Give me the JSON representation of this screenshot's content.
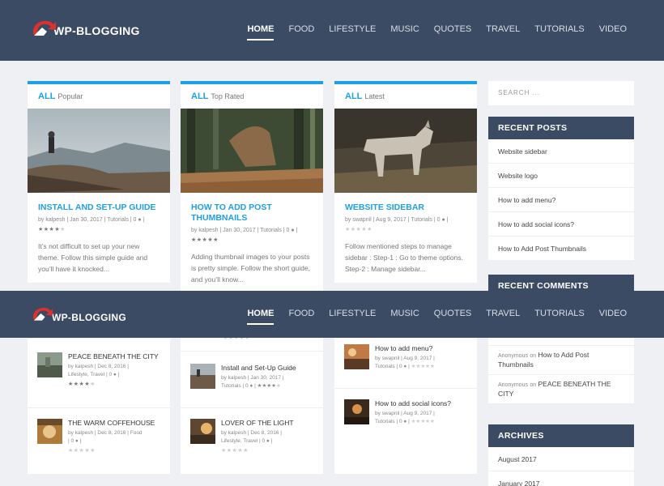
{
  "header": {
    "logo_text": "WP-BLOGGING",
    "nav": [
      "HOME",
      "FOOD",
      "LIFESTYLE",
      "MUSIC",
      "QUOTES",
      "TRAVEL",
      "TUTORIALS",
      "VIDEO"
    ],
    "active": "HOME"
  },
  "columns": [
    {
      "tab_all": "ALL",
      "tab_name": "Popular",
      "post": {
        "title": "INSTALL AND SET-UP GUIDE",
        "meta": "by kalpesh | Jan 30, 2017 | Tutorials | 0",
        "rating": 4,
        "excerpt": "It’s not difficult to set up your new theme. Follow this simple guide and you’ll have it knocked..."
      }
    },
    {
      "tab_all": "ALL",
      "tab_name": "Top Rated",
      "post": {
        "title": "HOW TO ADD POST THUMBNAILS",
        "meta": "by kalpesh | Jan 30, 2017 | Tutorials | 0",
        "rating": 5,
        "excerpt": "Adding thumbnail images to your posts is pretty simple. Follow the short guide, and you’ll know..."
      }
    },
    {
      "tab_all": "ALL",
      "tab_name": "Latest",
      "post": {
        "title": "WEBSITE SIDEBAR",
        "meta": "by swapnil | Aug 9, 2017 | Tutorials | 0",
        "rating": 0,
        "excerpt": "Follow mentioned steps to manage sidebar : Step-1 : Go to theme options. Step-2 : Manage sidebar..."
      }
    }
  ],
  "lower": {
    "col1": [
      {
        "title": "PEACE BENEATH THE CITY",
        "meta1": "by kalpesh | Dec 8, 2016 |",
        "meta2": "Lifestyle, Travel | 0",
        "rating": 4
      },
      {
        "title": "THE WARM COFFEHOUSE",
        "meta1": "by kalpesh | Dec 8, 2016 | Food",
        "meta2": "| 0",
        "rating": 0
      }
    ],
    "col2": [
      {
        "title": "Install and Set-Up Guide",
        "meta1": "by kalpesh | Jan 30, 2017 |",
        "meta2": "Tutorials | 0",
        "rating": 4
      },
      {
        "title": "LOVER OF THE LIGHT",
        "meta1": "by kalpesh | Dec 8, 2016 |",
        "meta2": "Lifestyle, Travel | 0",
        "rating": 0
      }
    ],
    "col3": [
      {
        "title": "How to add menu?",
        "meta1": "by swapnil | Aug 9, 2017 |",
        "meta2": "Tutorials | 0",
        "rating": 0
      },
      {
        "title": "How to add social icons?",
        "meta1": "by swapnil | Aug 9, 2017 |",
        "meta2": "Tutorials | 0",
        "rating": 0
      }
    ]
  },
  "sidebar": {
    "search_placeholder": "SEARCH ...",
    "recent_posts_title": "RECENT POSTS",
    "recent_posts": [
      "Website sidebar",
      "Website logo",
      "How to add menu?",
      "How to add social icons?",
      "How to Add Post Thumbnails"
    ],
    "recent_comments_title": "RECENT COMMENTS",
    "recent_comments": [
      {
        "author": "Anonymous",
        "on": "on",
        "post": "How to Add Post Thumbnails"
      },
      {
        "author": "Anonymous",
        "on": "on",
        "post": "PEACE BENEATH THE CITY"
      }
    ],
    "archives_title": "ARCHIVES",
    "archives": [
      "August 2017",
      "January 2017"
    ]
  },
  "colors": {
    "accent": "#1ea0e6",
    "header_bg": "#3a4b63",
    "page_bg": "#eef0f3"
  }
}
